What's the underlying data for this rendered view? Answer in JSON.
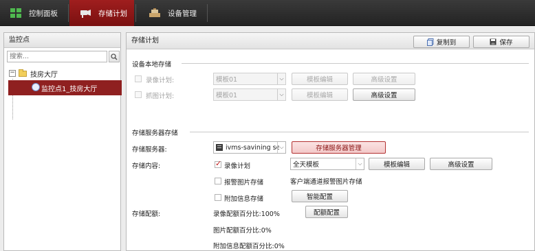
{
  "nav": {
    "tabs": [
      {
        "label": "控制面板",
        "icon": "grid-icon"
      },
      {
        "label": "存储计划",
        "icon": "camera-storage-icon"
      },
      {
        "label": "设备管理",
        "icon": "device-manage-icon"
      }
    ],
    "active_tab": "存储计划"
  },
  "sidebar": {
    "title": "监控点",
    "search_placeholder": "搜索...",
    "tree": {
      "root": {
        "label": "技房大厅",
        "expander": "−"
      },
      "child": {
        "label": "监控点1_技房大厅"
      }
    }
  },
  "main": {
    "title": "存储计划",
    "copy_label": "复制到",
    "save_label": "保存",
    "local": {
      "title": "设备本地存储",
      "record_plan": {
        "label": "录像计划:",
        "template": "模板01",
        "edit_label": "模板编辑",
        "advanced_label": "高级设置"
      },
      "capture_plan": {
        "label": "抓图计划:",
        "template": "模板01",
        "edit_label": "模板编辑",
        "advanced_label": "高级设置"
      }
    },
    "server": {
      "title": "存储服务器存储",
      "server_label": "存储服务器:",
      "server_value": "ivms-savining sen",
      "server_manage_label": "存储服务器管理",
      "content_label": "存储内容:",
      "record_plan_label": "录像计划",
      "record_plan_checked": true,
      "record_template": "全天模板",
      "template_edit_label": "模板编辑",
      "advanced_label": "高级设置",
      "alarm_pic_label": "报警图片存储",
      "alarm_pic_checked": false,
      "alarm_pic_note": "客户端通道报警图片存储",
      "extra_info_label": "附加信息存储",
      "extra_info_checked": false,
      "smart_config_label": "智能配置",
      "quota_label": "存储配额:",
      "record_quota": "录像配额百分比:100%",
      "quota_config_label": "配额配置",
      "pic_quota": "图片配额百分比:0%",
      "extra_quota": "附加信息配额百分比:0%"
    }
  }
}
